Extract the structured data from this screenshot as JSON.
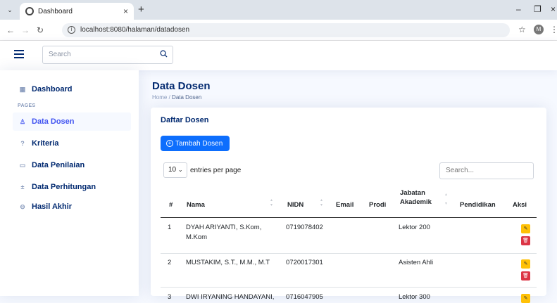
{
  "browser": {
    "tab_title": "Dashboard",
    "url": "localhost:8080/halaman/datadosen",
    "profile_initial": "M"
  },
  "header": {
    "search_placeholder": "Search"
  },
  "sidebar": {
    "pages_label": "PAGES",
    "items": [
      {
        "label": "Dashboard",
        "icon": "grid-icon"
      },
      {
        "label": "Data Dosen",
        "icon": "person-icon"
      },
      {
        "label": "Kriteria",
        "icon": "question-icon"
      },
      {
        "label": "Data Penilaian",
        "icon": "card-icon"
      },
      {
        "label": "Data Perhitungan",
        "icon": "calc-icon"
      },
      {
        "label": "Hasil Akhir",
        "icon": "minus-circle-icon"
      }
    ]
  },
  "page": {
    "title": "Data Dosen",
    "breadcrumb_home": "Home",
    "breadcrumb_sep": "/",
    "breadcrumb_current": "Data Dosen"
  },
  "card": {
    "title": "Daftar Dosen",
    "add_button": "Tambah Dosen",
    "per_page_value": "10",
    "per_page_label": "entries per page",
    "search_placeholder": "Search..."
  },
  "table": {
    "headers": [
      "#",
      "Nama",
      "NIDN",
      "Email",
      "Prodi",
      "Jabatan",
      "Akademik",
      "Pendidikan",
      "Aksi"
    ],
    "rows": [
      {
        "no": "1",
        "nama1": "DYAH ARIYANTI, S.Kom,",
        "nama2": "M.Kom",
        "nidn": "0719078402",
        "email": "",
        "prodi": "",
        "jabatan": "Lektor 200",
        "pendidikan": ""
      },
      {
        "no": "2",
        "nama1": "MUSTAKIM, S.T., M.M., M.T",
        "nama2": "",
        "nidn": "0720017301",
        "email": "",
        "prodi": "",
        "jabatan": "Asisten Ahli",
        "pendidikan": ""
      },
      {
        "no": "3",
        "nama1": "DWI IRYANING HANDAYANI,",
        "nama2": "",
        "nidn": "0716047905",
        "email": "",
        "prodi": "",
        "jabatan": "Lektor 300",
        "pendidikan": ""
      }
    ]
  },
  "colors": {
    "accent": "#4154f1",
    "primary_button": "#0d6efd",
    "edit_button": "#ffc107",
    "delete_button": "#dc3545"
  }
}
